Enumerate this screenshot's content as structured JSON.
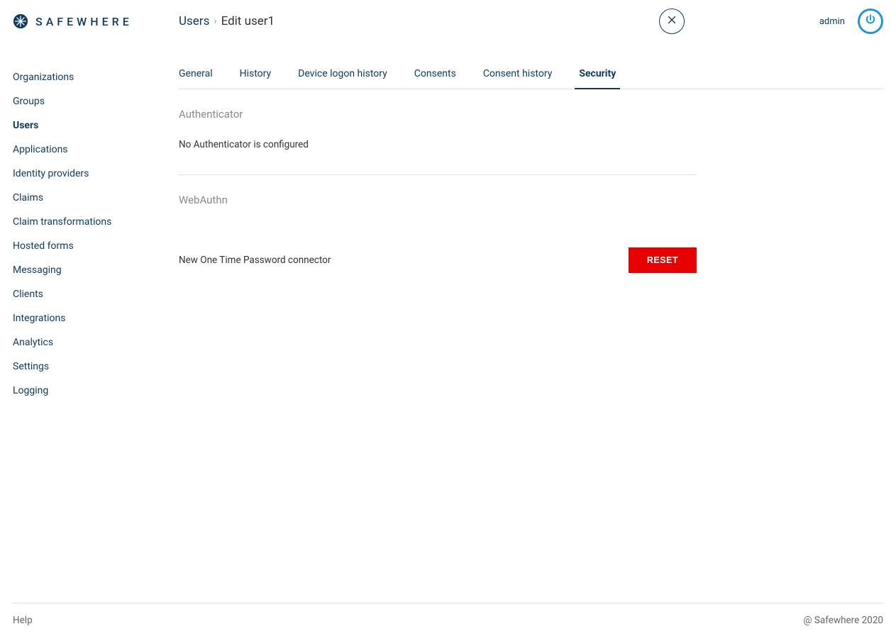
{
  "brand": {
    "name": "SAFEWHERE"
  },
  "breadcrumb": {
    "parent": "Users",
    "separator": "›",
    "current": "Edit user1"
  },
  "header": {
    "user": "admin"
  },
  "sidebar": {
    "items": [
      {
        "label": "Organizations",
        "active": false
      },
      {
        "label": "Groups",
        "active": false
      },
      {
        "label": "Users",
        "active": true
      },
      {
        "label": "Applications",
        "active": false
      },
      {
        "label": "Identity providers",
        "active": false
      },
      {
        "label": "Claims",
        "active": false
      },
      {
        "label": "Claim transformations",
        "active": false
      },
      {
        "label": "Hosted forms",
        "active": false
      },
      {
        "label": "Messaging",
        "active": false
      },
      {
        "label": "Clients",
        "active": false
      },
      {
        "label": "Integrations",
        "active": false
      },
      {
        "label": "Analytics",
        "active": false
      },
      {
        "label": "Settings",
        "active": false
      },
      {
        "label": "Logging",
        "active": false
      }
    ]
  },
  "tabs": [
    {
      "label": "General",
      "active": false
    },
    {
      "label": "History",
      "active": false
    },
    {
      "label": "Device logon history",
      "active": false
    },
    {
      "label": "Consents",
      "active": false
    },
    {
      "label": "Consent history",
      "active": false
    },
    {
      "label": "Security",
      "active": true
    }
  ],
  "sections": {
    "authenticator": {
      "title": "Authenticator",
      "empty_text": "No Authenticator is configured"
    },
    "webauthn": {
      "title": "WebAuthn",
      "item_label": "New One Time Password connector",
      "reset_label": "RESET"
    }
  },
  "footer": {
    "help": "Help",
    "copyright": "@ Safewhere 2020"
  }
}
